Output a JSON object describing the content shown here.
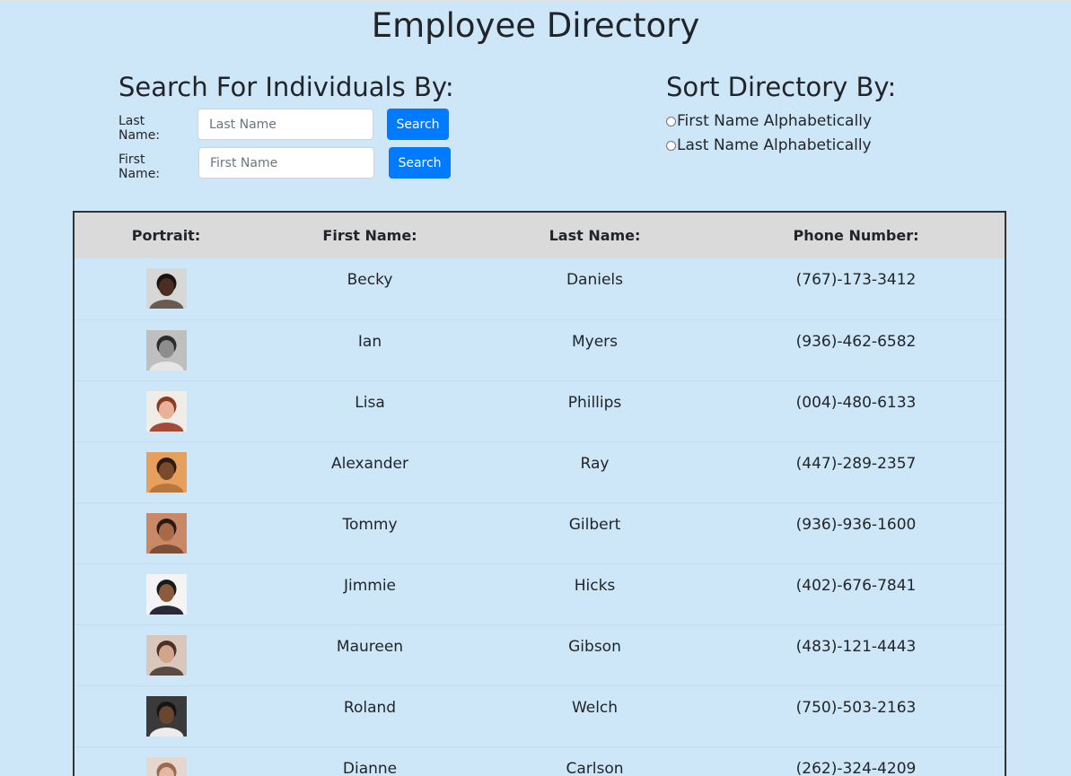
{
  "page": {
    "title": "Employee Directory"
  },
  "search": {
    "heading": "Search For Individuals By:",
    "last_name": {
      "label": "Last Name:",
      "placeholder": "Last Name",
      "value": "",
      "button": "Search"
    },
    "first_name": {
      "label": "First Name:",
      "placeholder": "First Name",
      "value": "",
      "button": "Search"
    }
  },
  "sort": {
    "heading": "Sort Directory By:",
    "options": [
      {
        "label": "First Name Alphabetically",
        "checked": false
      },
      {
        "label": "Last Name Alphabetically",
        "checked": false
      }
    ]
  },
  "table": {
    "headers": [
      "Portrait:",
      "First Name:",
      "Last Name:",
      "Phone Number:"
    ],
    "rows": [
      {
        "first": "Becky",
        "last": "Daniels",
        "phone": "(767)-173-3412",
        "portrait": {
          "bg": "#d7d7d7",
          "skin": "#4a2e22",
          "hair": "#1b1310",
          "shirt": "#6a5a52"
        }
      },
      {
        "first": "Ian",
        "last": "Myers",
        "phone": "(936)-462-6582",
        "portrait": {
          "bg": "#bfbfbf",
          "skin": "#8d8d8d",
          "hair": "#2b2b2b",
          "shirt": "#e6e6e6"
        }
      },
      {
        "first": "Lisa",
        "last": "Phillips",
        "phone": "(004)-480-6133",
        "portrait": {
          "bg": "#f0ece6",
          "skin": "#e7b19a",
          "hair": "#8c3a22",
          "shirt": "#a34a38"
        }
      },
      {
        "first": "Alexander",
        "last": "Ray",
        "phone": "(447)-289-2357",
        "portrait": {
          "bg": "#e6a05c",
          "skin": "#7b4a2c",
          "hair": "#2b1b12",
          "shirt": "#b6783f"
        }
      },
      {
        "first": "Tommy",
        "last": "Gilbert",
        "phone": "(936)-936-1600",
        "portrait": {
          "bg": "#c98866",
          "skin": "#a86a46",
          "hair": "#2a1c15",
          "shirt": "#7b5038"
        }
      },
      {
        "first": "Jimmie",
        "last": "Hicks",
        "phone": "(402)-676-7841",
        "portrait": {
          "bg": "#f4f4f4",
          "skin": "#8c5a3c",
          "hair": "#1a1a1a",
          "shirt": "#2a2a36"
        }
      },
      {
        "first": "Maureen",
        "last": "Gibson",
        "phone": "(483)-121-4443",
        "portrait": {
          "bg": "#d9c7bb",
          "skin": "#d2a48c",
          "hair": "#4a3026",
          "shirt": "#5a4a44"
        }
      },
      {
        "first": "Roland",
        "last": "Welch",
        "phone": "(750)-503-2163",
        "portrait": {
          "bg": "#3a3a3a",
          "skin": "#6a4630",
          "hair": "#151515",
          "shirt": "#ececec"
        }
      },
      {
        "first": "Dianne",
        "last": "Carlson",
        "phone": "(262)-324-4209",
        "portrait": {
          "bg": "#e6d6d0",
          "skin": "#e2b8a6",
          "hair": "#9a6a4a",
          "shirt": "#c0a8a0"
        }
      }
    ]
  }
}
